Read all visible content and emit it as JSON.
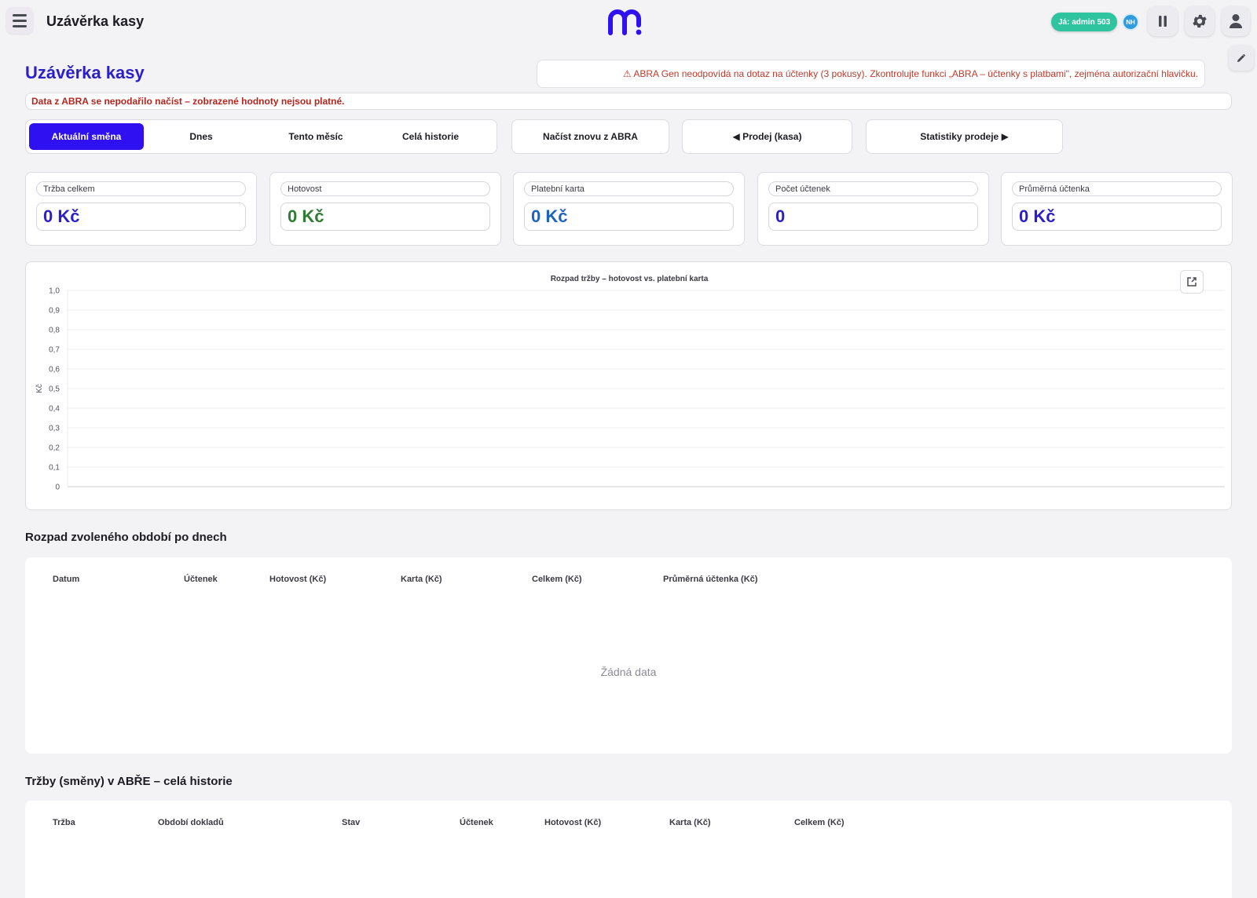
{
  "header": {
    "app_title": "Uzávěrka kasy",
    "user_badge": "Já: admin 503",
    "user_initials": "NH",
    "brand_color": "#2f10f0"
  },
  "page": {
    "title": "Uzávěrka kasy",
    "abra_warning": "⚠ ABRA Gen neodpovídá na dotaz na účtenky (3 pokusy). Zkontrolujte funkci „ABRA – účtenky s platbami\", zejména autorizační hlavičku.",
    "load_error": "Data z ABRA se nepodařilo načíst – zobrazené hodnoty nejsou platné."
  },
  "period_tabs": [
    {
      "label": "Aktuální směna",
      "active": true
    },
    {
      "label": "Dnes",
      "active": false
    },
    {
      "label": "Tento měsíc",
      "active": false
    },
    {
      "label": "Celá historie",
      "active": false
    }
  ],
  "actions": {
    "reload": "Načíst znovu z ABRA",
    "sale": "◀ Prodej (kasa)",
    "stats": "Statistiky prodeje ▶"
  },
  "kpis": [
    {
      "label": "Tržba celkem",
      "value": "0 Kč",
      "color": "#2b1fc9"
    },
    {
      "label": "Hotovost",
      "value": "0 Kč",
      "color": "#2e7d32"
    },
    {
      "label": "Platební karta",
      "value": "0 Kč",
      "color": "#1e63c2"
    },
    {
      "label": "Počet účtenek",
      "value": "0",
      "color": "#2b1fc9"
    },
    {
      "label": "Průměrná účtenka",
      "value": "0 Kč",
      "color": "#2b1fc9"
    }
  ],
  "chart_data": {
    "type": "bar",
    "title": "Rozpad tržby – hotovost vs. platební karta",
    "xlabel": "",
    "ylabel": "Kč",
    "ylim": [
      0,
      1
    ],
    "yticks": [
      "0",
      "0,1",
      "0,2",
      "0,3",
      "0,4",
      "0,5",
      "0,6",
      "0,7",
      "0,8",
      "0,9",
      "1,0"
    ],
    "categories": [],
    "series": [],
    "grid": true
  },
  "daily": {
    "title": "Rozpad zvoleného období po dnech",
    "columns": [
      "Datum",
      "Účtenek",
      "Hotovost (Kč)",
      "Karta (Kč)",
      "Celkem (Kč)",
      "Průměrná účtenka (Kč)"
    ],
    "rows": [],
    "empty_text": "Žádná data"
  },
  "history": {
    "title": "Tržby (směny) v ABŘE – celá historie",
    "columns": [
      "Tržba",
      "Období dokladů",
      "Stav",
      "Účtenek",
      "Hotovost (Kč)",
      "Karta (Kč)",
      "Celkem (Kč)"
    ],
    "rows": []
  }
}
